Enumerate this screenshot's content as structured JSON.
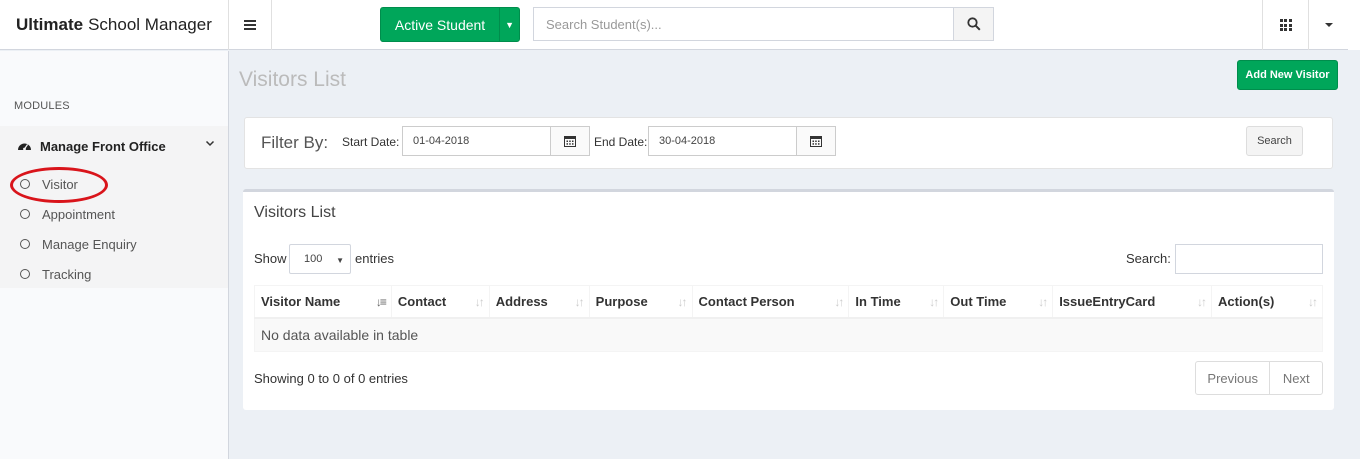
{
  "brand": {
    "bold": "Ultimate",
    "rest": "School Manager"
  },
  "header": {
    "active_student_label": "Active Student",
    "search_placeholder": "Search Student(s)...",
    "apps_icon": "apps-grid-icon",
    "user_menu_icon": "caret-down-icon"
  },
  "sidebar": {
    "modules_header": "MODULES",
    "group": {
      "label": "Manage Front Office",
      "icon": "dashboard-icon"
    },
    "items": [
      {
        "label": "Visitor"
      },
      {
        "label": "Appointment"
      },
      {
        "label": "Manage Enquiry"
      },
      {
        "label": "Tracking"
      }
    ]
  },
  "page": {
    "title": "Visitors List",
    "add_button": "Add New Visitor"
  },
  "filter": {
    "label": "Filter By:",
    "start_label": "Start Date:",
    "start_value": "01-04-2018",
    "end_label": "End Date:",
    "end_value": "30-04-2018",
    "search_button": "Search"
  },
  "list": {
    "title": "Visitors List",
    "show_label": "Show",
    "entries_value": "100",
    "entries_label": "entries",
    "search_label": "Search:",
    "columns": [
      "Visitor Name",
      "Contact",
      "Address",
      "Purpose",
      "Contact Person",
      "In Time",
      "Out Time",
      "IssueEntryCard",
      "Action(s)"
    ],
    "empty_message": "No data available in table",
    "showing_info": "Showing 0 to 0 of 0 entries",
    "prev_label": "Previous",
    "next_label": "Next"
  },
  "colors": {
    "accent_green": "#00a65a",
    "annotation_red": "#d9141b"
  }
}
